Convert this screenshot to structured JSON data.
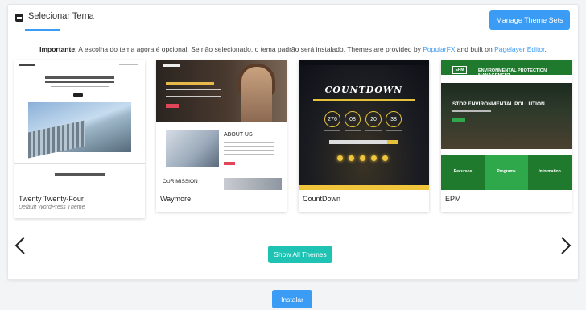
{
  "panel": {
    "title": "Selecionar Tema",
    "manage_button": "Manage Theme Sets"
  },
  "notice": {
    "bold": "Importante",
    "text_before_link1": ": A escolha do tema agora é opcional. Se não selecionado, o tema padrão será instalado. Themes are provided by ",
    "link1": "PopularFX",
    "text_between": " and built on ",
    "link2": "Pagelayer Editor",
    "text_after": "."
  },
  "themes": [
    {
      "name": "Twenty Twenty-Four",
      "subtitle": "Default WordPress Theme"
    },
    {
      "name": "Waymore",
      "subtitle": ""
    },
    {
      "name": "CountDown",
      "subtitle": ""
    },
    {
      "name": "EPM",
      "subtitle": ""
    }
  ],
  "previews": {
    "waymore": {
      "about": "ABOUT US",
      "mission": "OUR MISSION"
    },
    "countdown": {
      "title": "COUNTDOWN",
      "digits": [
        "276",
        "08",
        "20",
        "38"
      ]
    },
    "epm": {
      "logo": "EPM",
      "org": "ENVIRONMENTAL PROTECTION MANAGEMENT",
      "headline": "STOP ENVIRONMENTAL POLLUTION.",
      "columns": [
        "Recursos",
        "Programs",
        "Information"
      ]
    }
  },
  "actions": {
    "show_all": "Show All Themes",
    "install": "Instalar"
  },
  "icons": {
    "collapse": "minus-square-icon",
    "prev": "chevron-left-icon",
    "next": "chevron-right-icon"
  },
  "colors": {
    "primary": "#3b9cf5",
    "teal": "#1ec3b3"
  }
}
